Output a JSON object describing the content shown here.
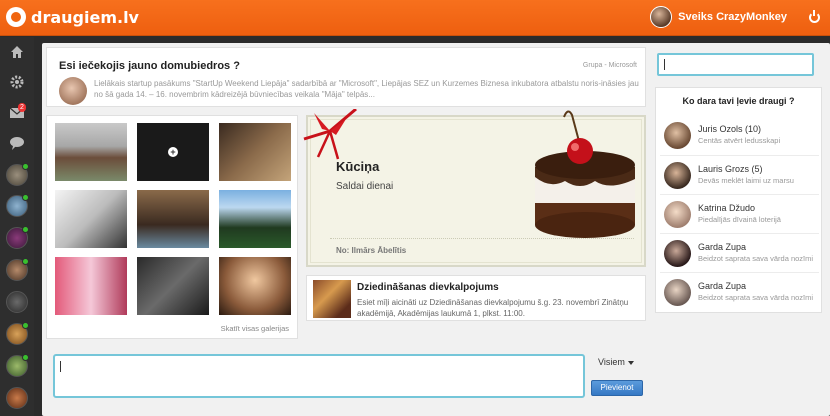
{
  "app": {
    "name": "draugiem.lv",
    "greeting": "Sveiks CrazyMonkey"
  },
  "nav": {
    "mail_badge": "2",
    "icons": [
      "home-icon",
      "gear-icon",
      "mail-icon",
      "chat-icon"
    ]
  },
  "question": {
    "title": "Esi iečekojis jauno domubiedros ?",
    "group": "Grupa - Microsoft",
    "text": "Lielākais startup pasākums \"StartUp Weekend Liepāja\" sadarbībā ar \"Microsoft\", Liepājas SEZ un Kurzemes Biznesa inkubatora atbalstu noris-ināsies jau no šā gada 14. – 16. novembrim kādreizējā būvniecības veikala \"Māja\" telpās..."
  },
  "gallery": {
    "link": "Skatīt visas galerijas"
  },
  "birthday": {
    "title": "Kūciņa",
    "subtitle": "Saldai dienai",
    "from": "No: Ilmārs Ābelītis"
  },
  "event": {
    "title": "Dziedināšanas dievkalpojums",
    "text": "Esiet mīļi aicināti uz Dziedināšanas dievkalpojumu š.g. 23. novembrī Zinātņu akadēmijā, Akadēmijas laukumā 1, plkst. 11:00."
  },
  "friends": {
    "title": "Ko dara tavi ļevie draugi ?",
    "items": [
      {
        "name": "Juris Ozols (10)",
        "desc": "Centās atvērt ledusskapi"
      },
      {
        "name": "Lauris Grozs (5)",
        "desc": "Devās meklēt laimi uz marsu"
      },
      {
        "name": "Katrina Džudo",
        "desc": "Piedalījās dīvainā loterijā"
      },
      {
        "name": "Garda Zupa",
        "desc": "Beidzot saprata sava vārda nozīmi"
      },
      {
        "name": "Garda Zupa",
        "desc": "Beidzot saprata sava vārda nozīmi"
      }
    ]
  },
  "composer": {
    "audience": "Visiem",
    "post_label": "Pievienot"
  },
  "colors": {
    "brand": "#f0650f",
    "accent": "#75c6d9",
    "button": "#3a7dc8",
    "online": "#39c02e"
  }
}
